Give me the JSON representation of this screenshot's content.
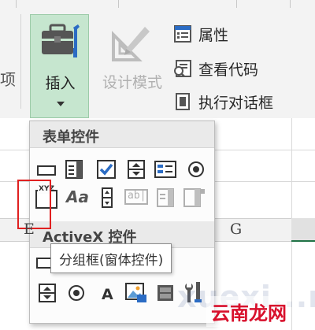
{
  "ribbon": {
    "left_partial_label": "项",
    "insert": {
      "label": "插入"
    },
    "design_mode": {
      "label": "设计模式"
    },
    "properties": {
      "label": "属性"
    },
    "view_code": {
      "label": "查看代码"
    },
    "run_dialog": {
      "label": "执行对话框"
    }
  },
  "dropdown": {
    "form_controls_title": "表单控件",
    "activex_title": "ActiveX 控件",
    "form_controls_row1": [
      "button-icon",
      "combo-box-icon",
      "checkbox-icon",
      "spin-button-icon",
      "list-box-icon",
      "option-button-icon"
    ],
    "form_controls_row2": [
      "group-box-icon",
      "label-icon",
      "scroll-bar-icon",
      "text-field-icon",
      "combo-list-edit-icon",
      "combo-drop-edit-icon"
    ],
    "activex_row2": [
      "spin-button-icon",
      "option-button-icon",
      "label-icon",
      "image-icon",
      "toggle-button-icon",
      "more-controls-icon"
    ],
    "group_box_caption": "XYZ",
    "label_caption": "Aa",
    "textfield_caption": "ab|"
  },
  "tooltip": {
    "text": "分组框(窗体控件)"
  },
  "sheet": {
    "partial_header_left": "E",
    "column_g": "G"
  },
  "watermark": {
    "latin": "xuexi...m",
    "cn": "云南龙网"
  },
  "colors": {
    "ribbon_bg": "#f3f3f3",
    "insert_highlight": "#c6e6cf",
    "checkbox_blue": "#2b6cc4",
    "highlight_red": "#e02020",
    "excel_green": "#217346"
  }
}
